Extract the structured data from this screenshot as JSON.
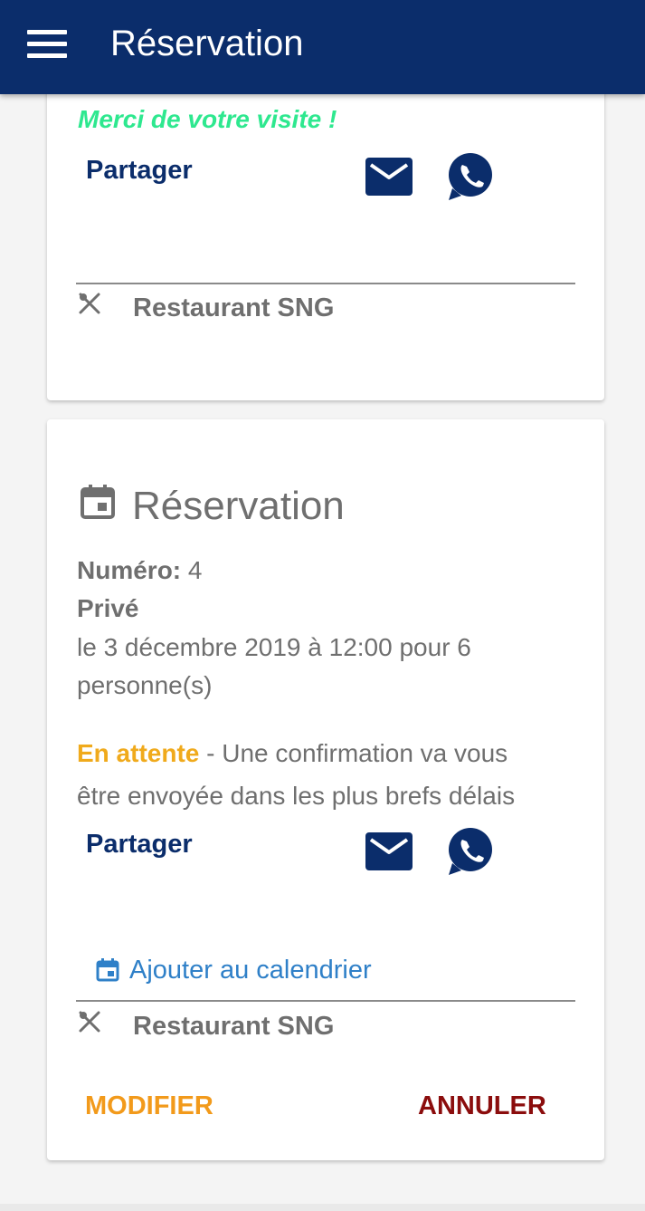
{
  "appbar": {
    "title": "Réservation",
    "menu_icon": "hamburger-menu-icon",
    "background": "#0b2d6b"
  },
  "previous_card": {
    "thanks_message": "Merci de votre visite !",
    "share_label": "Partager",
    "share_icons": [
      "email-icon",
      "whatsapp-icon"
    ],
    "restaurant_icon": "fork-knife-icon",
    "restaurant_name": "Restaurant SNG"
  },
  "reservation_card": {
    "header_icon": "calendar-icon",
    "title": "Réservation",
    "number_label": "Numéro:",
    "number_value": "4",
    "type": "Privé",
    "date_line_1": "le 3 décembre 2019 à 12:00 pour 6",
    "date_line_2": "personne(s)",
    "status": "En attente",
    "status_line_1": " - Une confirmation va vous",
    "status_line_2": "être envoyée dans les plus brefs délais",
    "share_label": "Partager",
    "share_icons": [
      "email-icon",
      "whatsapp-icon"
    ],
    "add_calendar_icon": "calendar-icon",
    "add_calendar_label": "Ajouter au calendrier",
    "restaurant_icon": "fork-knife-icon",
    "restaurant_name": "Restaurant SNG",
    "modify_button": "MODIFIER",
    "cancel_button": "ANNULER"
  },
  "colors": {
    "primary": "#0b2d6b",
    "thanks_green": "#2ee88f",
    "status_pending": "#f0aa1c",
    "link_blue": "#2f80c8",
    "modify_orange": "#f29a1b",
    "cancel_red": "#8b0d0d"
  }
}
